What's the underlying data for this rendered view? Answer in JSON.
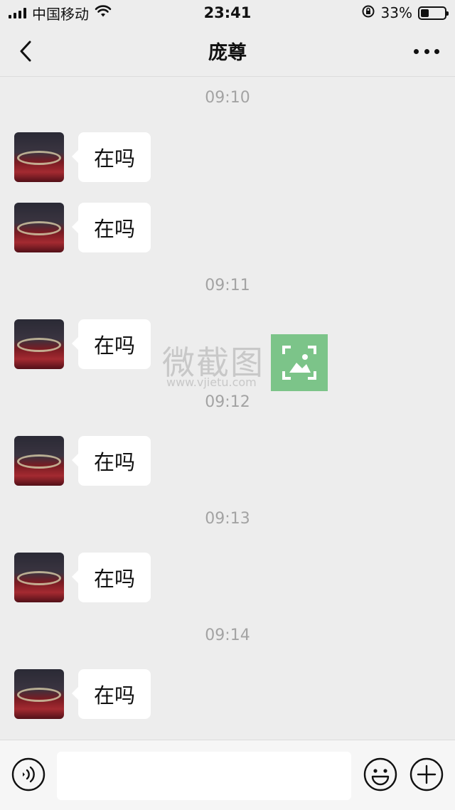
{
  "status_bar": {
    "carrier": "中国移动",
    "time": "23:41",
    "battery_percent": "33%",
    "battery_level": 0.33,
    "icons": [
      "signal-icon",
      "wifi-icon",
      "orientation-lock-icon",
      "battery-icon"
    ]
  },
  "nav": {
    "title": "庞尊",
    "icons": [
      "back-arrow-icon",
      "more-dots-icon"
    ]
  },
  "conversation": [
    {
      "type": "timestamp",
      "text": "09:10"
    },
    {
      "type": "message",
      "text": "在吗"
    },
    {
      "type": "message",
      "text": "在吗"
    },
    {
      "type": "timestamp",
      "text": "09:11"
    },
    {
      "type": "message",
      "text": "在吗"
    },
    {
      "type": "timestamp",
      "text": "09:12"
    },
    {
      "type": "message",
      "text": "在吗"
    },
    {
      "type": "timestamp",
      "text": "09:13"
    },
    {
      "type": "message",
      "text": "在吗"
    },
    {
      "type": "timestamp",
      "text": "09:14"
    },
    {
      "type": "message",
      "text": "在吗"
    }
  ],
  "watermark": {
    "text": "微截图",
    "url": "www.vjietu.com"
  },
  "input_bar": {
    "value": "",
    "icons": [
      "voice-icon",
      "emoji-icon",
      "plus-icon"
    ]
  },
  "colors": {
    "background": "#ededed",
    "bubble": "#ffffff",
    "timestamp": "#a3a3a3",
    "watermark_green": "#7cc489"
  }
}
